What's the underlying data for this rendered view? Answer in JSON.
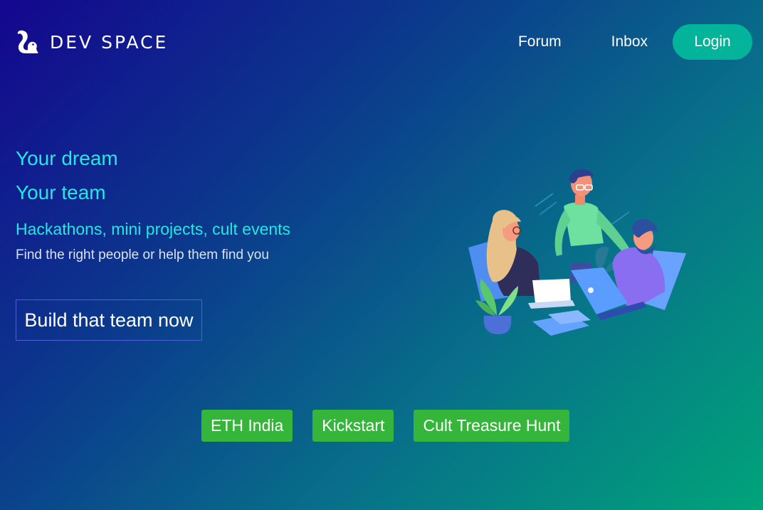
{
  "brand": {
    "name": "DEV SPACE",
    "logo_icon": "squirrel-icon"
  },
  "nav": {
    "forum": "Forum",
    "inbox": "Inbox",
    "login": "Login"
  },
  "hero": {
    "line1": "Your dream",
    "line2": "Your team",
    "subtitle": "Hackathons, mini projects, cult events",
    "description": "Find the right people or help them find you"
  },
  "cta": {
    "label": "Build that team now"
  },
  "events": [
    {
      "label": "ETH India"
    },
    {
      "label": "Kickstart"
    },
    {
      "label": "Cult Treasure Hunt"
    }
  ],
  "colors": {
    "accent_text": "#22e8e0",
    "login_bg": "#03b39a",
    "chip_bg": "#36b53b",
    "gradient_start": "#14068f",
    "gradient_end": "#00a47a"
  }
}
